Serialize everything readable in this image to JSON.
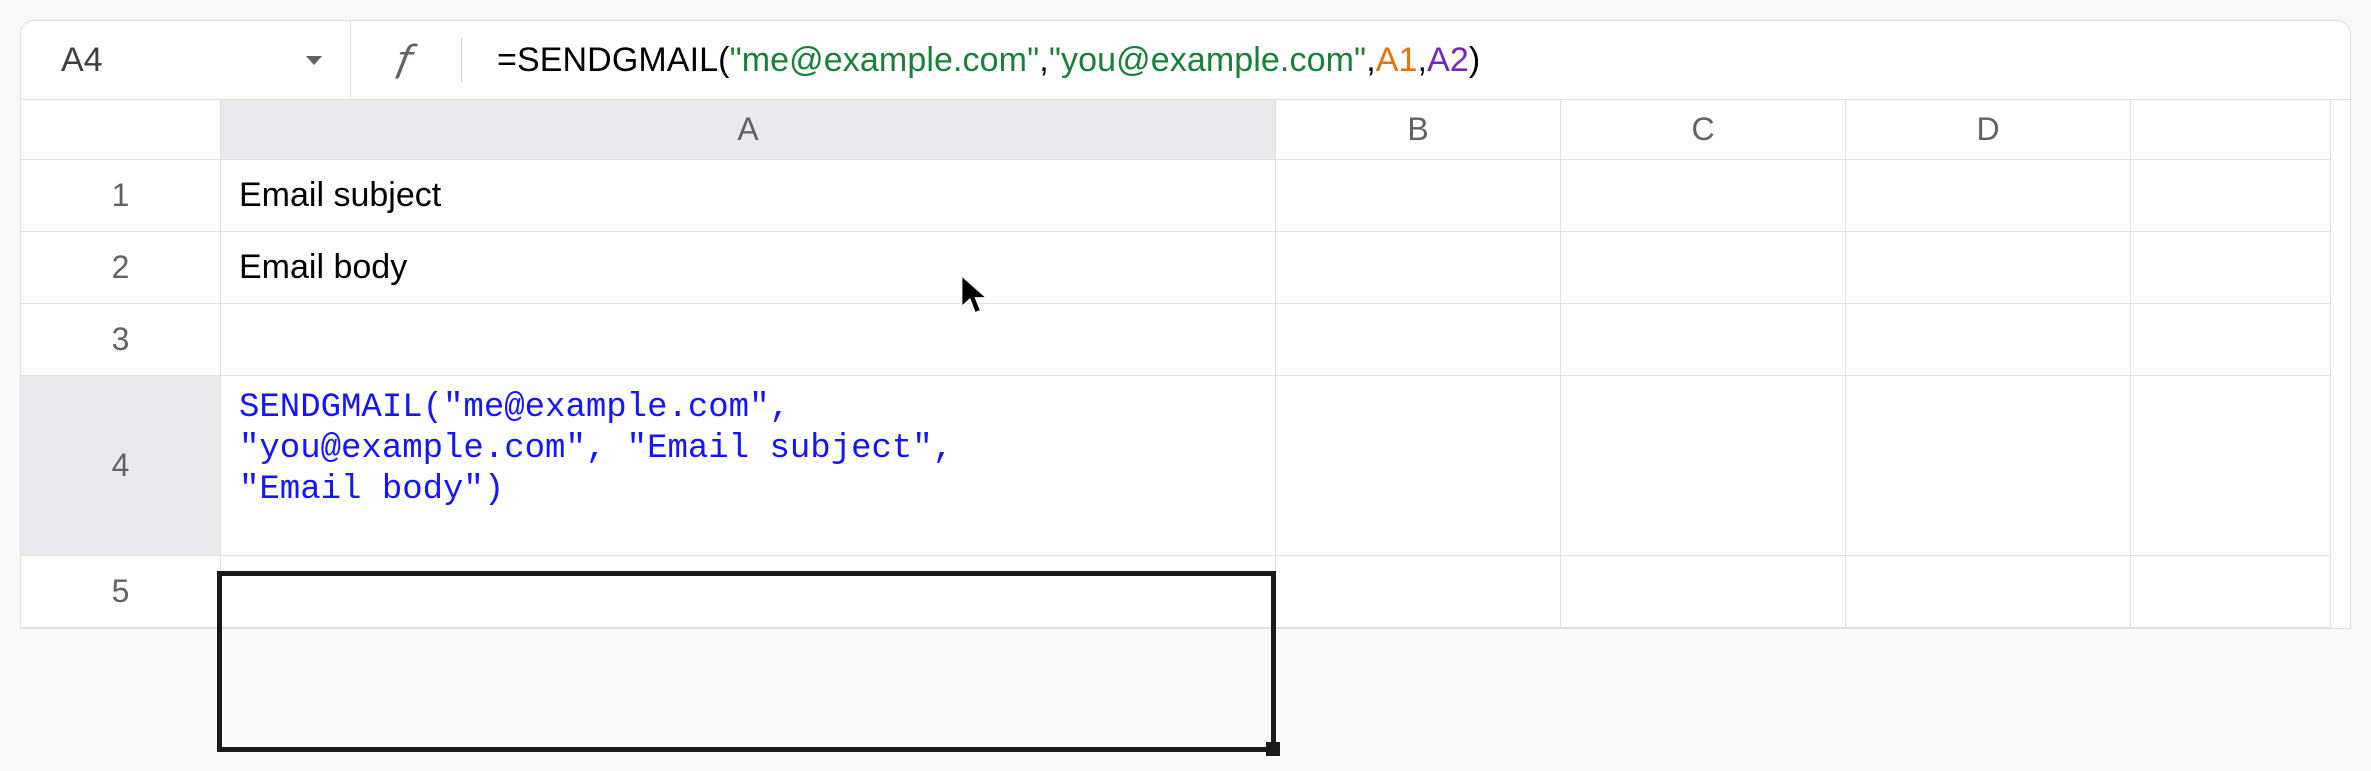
{
  "nameBox": {
    "value": "A4"
  },
  "formulaBar": {
    "prefix": "=",
    "fn": "SENDGMAIL",
    "open": "(",
    "arg1": "\"me@example.com\"",
    "sep1": ",",
    "arg2": "\"you@example.com\"",
    "sep2": ",",
    "arg3": "A1",
    "sep3": ",",
    "arg4": "A2",
    "close": ")"
  },
  "columns": [
    "A",
    "B",
    "C",
    "D"
  ],
  "rows": [
    "1",
    "2",
    "3",
    "4",
    "5"
  ],
  "cells": {
    "A1": "Email subject",
    "A2": "Email body",
    "A3": "",
    "A4": "SENDGMAIL(\"me@example.com\",\n\"you@example.com\", \"Email subject\",\n\"Email body\")",
    "A5": ""
  },
  "selection": {
    "cell": "A4"
  }
}
